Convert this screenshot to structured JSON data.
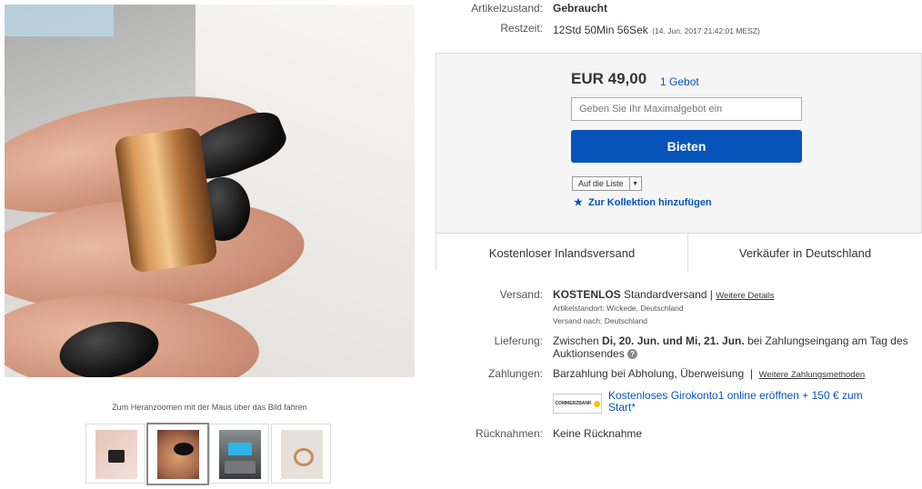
{
  "item": {
    "condition_label": "Artikelzustand:",
    "condition_value": "Gebraucht",
    "time_left_label": "Restzeit:",
    "time_left_value": "12Std 50Min 56Sek",
    "time_left_end": "(14. Jun. 2017   21:42:01 MESZ)"
  },
  "gallery": {
    "zoom_hint": "Zum Heranzoomen mit der Maus über das Bild fahren",
    "thumbnails": [
      "thumb-1",
      "thumb-2",
      "thumb-3",
      "thumb-4"
    ],
    "active_index": 1
  },
  "bid": {
    "price": "EUR 49,00",
    "bid_count": "1 Gebot",
    "input_placeholder": "Geben Sie Ihr Maximalgebot ein",
    "button_label": "Bieten",
    "watch_label": "Auf die Liste",
    "collection_label": "Zur Kollektion hinzufügen",
    "accent_color": "#0654ba"
  },
  "highlights": {
    "shipping": "Kostenloser Inlandsversand",
    "seller": "Verkäufer in Deutschland"
  },
  "shipping": {
    "label": "Versand:",
    "cost": "KOSTENLOS",
    "method": "Standardversand",
    "sep": "|",
    "details_link": "Weitere Details",
    "location": "Artikelstandort:  Wickede, Deutschland",
    "ships_to": "Versand nach:  Deutschland"
  },
  "delivery": {
    "label": "Lieferung:",
    "prefix": "Zwischen",
    "dates": "Di, 20. Jun. und Mi, 21. Jun.",
    "suffix": "bei Zahlungseingang am Tag des",
    "line2": "Auktionsendes"
  },
  "payment": {
    "label": "Zahlungen:",
    "methods": "Barzahlung bei Abholung,  Überweisung",
    "sep": "|",
    "more_link": "Weitere Zahlungsmethoden",
    "promo_logo": "COMMERZBANK",
    "promo_line1": "Kostenloses Girokonto1 online eröffnen + 150 € zum",
    "promo_line2": "Start*"
  },
  "returns": {
    "label": "Rücknahmen:",
    "value": "Keine Rücknahme"
  }
}
